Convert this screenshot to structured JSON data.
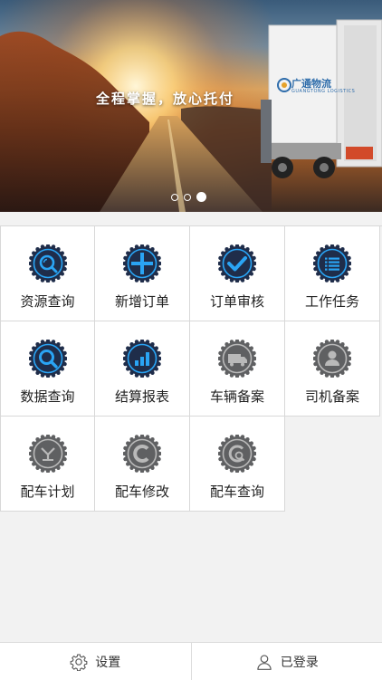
{
  "banner": {
    "slogan": "全程掌握，放心托付",
    "logo_text": "广通物流",
    "logo_sub": "GUANGTONG LOGISTICS",
    "slides": 3,
    "active_slide": 3
  },
  "menu": [
    {
      "label": "资源查询",
      "icon": "resource-search-icon",
      "active": true
    },
    {
      "label": "新增订单",
      "icon": "plus-icon",
      "active": true
    },
    {
      "label": "订单审核",
      "icon": "check-icon",
      "active": true
    },
    {
      "label": "工作任务",
      "icon": "list-icon",
      "active": true
    },
    {
      "label": "数据查询",
      "icon": "search-icon",
      "active": true
    },
    {
      "label": "结算报表",
      "icon": "bar-chart-icon",
      "active": true
    },
    {
      "label": "车辆备案",
      "icon": "truck-icon",
      "active": false
    },
    {
      "label": "司机备案",
      "icon": "driver-icon",
      "active": false
    },
    {
      "label": "配车计划",
      "icon": "plan-icon",
      "active": false
    },
    {
      "label": "配车修改",
      "icon": "modify-icon",
      "active": false
    },
    {
      "label": "配车查询",
      "icon": "dispatch-search-icon",
      "active": false
    }
  ],
  "bottom": {
    "settings_label": "设置",
    "login_label": "已登录"
  },
  "colors": {
    "active_icon": "#1f2d4a",
    "active_accent": "#2aa4f4",
    "disabled_icon": "#5f6062",
    "disabled_accent": "#b9b9b9"
  }
}
